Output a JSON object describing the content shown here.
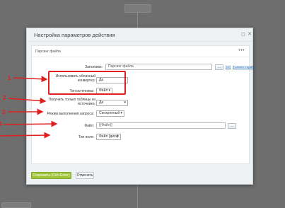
{
  "background": {
    "top_node_label": ""
  },
  "dialog": {
    "title": "Настройка параметров действия",
    "maximize_icon": "maximize-icon",
    "close_icon": "close-icon",
    "panel_caption": "Парсинг файла",
    "panel_menu": "•••",
    "rows": {
      "title_label": "Заголовок:",
      "title_value": "Парсинг файла",
      "title_button": "...",
      "link_var": "[ID]",
      "link_comment": "[Комментарий]",
      "cloud_label": "Использовать облачный конвертер:",
      "cloud_value": "Да",
      "source_type_label": "Тип источника:",
      "source_type_value": "Файл",
      "only_tables_label": "Получить только таблицы из источника:",
      "only_tables_value": "Да",
      "mode_label": "Режим выполнения запроса:",
      "mode_value": "Синхронный",
      "file_label": "Файл:",
      "file_value": "{{Файл}}",
      "file_button": "...",
      "field_type_label": "Тип поля:",
      "field_type_value": "Файл (диск)"
    },
    "footer": {
      "save_label": "Сохранить (Ctrl+Enter)",
      "cancel_label": "Отменить"
    }
  },
  "annotations": [
    "1",
    "2",
    "3",
    "4"
  ],
  "colors": {
    "annotation_red": "#e02020",
    "save_green": "#9fc53a"
  }
}
